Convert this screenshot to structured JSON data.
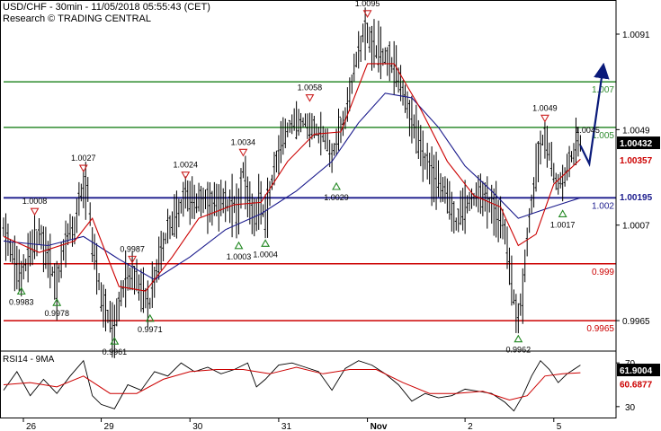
{
  "header": {
    "title": "USD/CHF - 30min - 11/05/2018 05:55:43 (CET)",
    "credit": "Research © TRADING CENTRAL"
  },
  "colors": {
    "candles": "#000000",
    "ma_fast": "#cc0000",
    "ma_slow": "#1a1a8c",
    "resistance": "#2e8b2e",
    "pivot": "#1a1a8c",
    "support": "#cc0000",
    "forecast_arrow": "#0a1a7a",
    "price_badge": "#000000",
    "fast_badge": "#cc0000",
    "pivot_badge": "#1a1a8c"
  },
  "chart_data": [
    {
      "type": "candlestick",
      "title": "USD/CHF - 30min - 11/05/2018 05:55:43 (CET)",
      "ylim": [
        0.9952,
        1.0106
      ],
      "y_ticks": [
        "1.0091",
        "1.0049",
        "1.0007",
        "0.9965"
      ],
      "x_ticks": [
        "26",
        "29",
        "30",
        "31",
        "Nov",
        "2",
        "5"
      ],
      "grid": false,
      "price_path": [
        {
          "x": 0,
          "y": 1.0006
        },
        {
          "x": 2,
          "y": 0.9994
        },
        {
          "x": 4,
          "y": 0.9985
        },
        {
          "x": 6,
          "y": 0.9995
        },
        {
          "x": 8,
          "y": 1.0003
        },
        {
          "x": 10,
          "y": 0.9993
        },
        {
          "x": 12,
          "y": 0.998
        },
        {
          "x": 14,
          "y": 1.0002
        },
        {
          "x": 16,
          "y": 1.0006
        },
        {
          "x": 18,
          "y": 1.0026
        },
        {
          "x": 19,
          "y": 1.0022
        },
        {
          "x": 20,
          "y": 1.0
        },
        {
          "x": 22,
          "y": 0.9975
        },
        {
          "x": 24,
          "y": 0.9965
        },
        {
          "x": 25,
          "y": 0.9963
        },
        {
          "x": 27,
          "y": 0.998
        },
        {
          "x": 29,
          "y": 0.9986
        },
        {
          "x": 31,
          "y": 0.9978
        },
        {
          "x": 33,
          "y": 0.9973
        },
        {
          "x": 35,
          "y": 0.9992
        },
        {
          "x": 37,
          "y": 1.0005
        },
        {
          "x": 39,
          "y": 1.001
        },
        {
          "x": 41,
          "y": 1.0022
        },
        {
          "x": 43,
          "y": 1.0016
        },
        {
          "x": 45,
          "y": 1.0018
        },
        {
          "x": 47,
          "y": 1.0017
        },
        {
          "x": 49,
          "y": 1.0018
        },
        {
          "x": 51,
          "y": 1.0016
        },
        {
          "x": 53,
          "y": 1.0014
        },
        {
          "x": 54,
          "y": 1.003
        },
        {
          "x": 55,
          "y": 1.0022
        },
        {
          "x": 56,
          "y": 1.0011
        },
        {
          "x": 58,
          "y": 1.0015
        },
        {
          "x": 59,
          "y": 1.001
        },
        {
          "x": 61,
          "y": 1.0031
        },
        {
          "x": 63,
          "y": 1.0046
        },
        {
          "x": 65,
          "y": 1.0052
        },
        {
          "x": 67,
          "y": 1.0053
        },
        {
          "x": 69,
          "y": 1.0051
        },
        {
          "x": 71,
          "y": 1.0048
        },
        {
          "x": 73,
          "y": 1.0044
        },
        {
          "x": 74,
          "y": 1.0035
        },
        {
          "x": 75,
          "y": 1.0045
        },
        {
          "x": 77,
          "y": 1.0055
        },
        {
          "x": 79,
          "y": 1.0075
        },
        {
          "x": 81,
          "y": 1.009
        },
        {
          "x": 82,
          "y": 1.0093
        },
        {
          "x": 83,
          "y": 1.0085
        },
        {
          "x": 85,
          "y": 1.0082
        },
        {
          "x": 87,
          "y": 1.008
        },
        {
          "x": 89,
          "y": 1.0072
        },
        {
          "x": 91,
          "y": 1.006
        },
        {
          "x": 93,
          "y": 1.0047
        },
        {
          "x": 95,
          "y": 1.0035
        },
        {
          "x": 97,
          "y": 1.0028
        },
        {
          "x": 99,
          "y": 1.0022
        },
        {
          "x": 101,
          "y": 1.0015
        },
        {
          "x": 102,
          "y": 1.0008
        },
        {
          "x": 103,
          "y": 1.0014
        },
        {
          "x": 105,
          "y": 1.0018
        },
        {
          "x": 107,
          "y": 1.002
        },
        {
          "x": 109,
          "y": 1.0017
        },
        {
          "x": 111,
          "y": 1.0013
        },
        {
          "x": 113,
          "y": 1.0005
        },
        {
          "x": 114,
          "y": 0.999
        },
        {
          "x": 115,
          "y": 0.9975
        },
        {
          "x": 116,
          "y": 0.9966
        },
        {
          "x": 117,
          "y": 0.9975
        },
        {
          "x": 118,
          "y": 1.0
        },
        {
          "x": 119,
          "y": 1.0015
        },
        {
          "x": 120,
          "y": 1.003
        },
        {
          "x": 121,
          "y": 1.0042
        },
        {
          "x": 122,
          "y": 1.0046
        },
        {
          "x": 123,
          "y": 1.004
        },
        {
          "x": 124,
          "y": 1.003
        },
        {
          "x": 125,
          "y": 1.0025
        },
        {
          "x": 126,
          "y": 1.0026
        },
        {
          "x": 127,
          "y": 1.0032
        },
        {
          "x": 128,
          "y": 1.0037
        },
        {
          "x": 129,
          "y": 1.0041
        },
        {
          "x": 130,
          "y": 1.0043
        }
      ],
      "ma_fast": [
        {
          "x": 0,
          "y": 1.0002
        },
        {
          "x": 8,
          "y": 0.9995
        },
        {
          "x": 16,
          "y": 1.0
        },
        {
          "x": 20,
          "y": 1.001
        },
        {
          "x": 26,
          "y": 0.998
        },
        {
          "x": 32,
          "y": 0.9978
        },
        {
          "x": 38,
          "y": 0.9993
        },
        {
          "x": 44,
          "y": 1.001
        },
        {
          "x": 52,
          "y": 1.0016
        },
        {
          "x": 58,
          "y": 1.0017
        },
        {
          "x": 64,
          "y": 1.0035
        },
        {
          "x": 70,
          "y": 1.0047
        },
        {
          "x": 76,
          "y": 1.0048
        },
        {
          "x": 82,
          "y": 1.0078
        },
        {
          "x": 88,
          "y": 1.0078
        },
        {
          "x": 94,
          "y": 1.0058
        },
        {
          "x": 100,
          "y": 1.0035
        },
        {
          "x": 106,
          "y": 1.002
        },
        {
          "x": 112,
          "y": 1.0015
        },
        {
          "x": 116,
          "y": 0.9998
        },
        {
          "x": 120,
          "y": 1.0003
        },
        {
          "x": 124,
          "y": 1.0025
        },
        {
          "x": 130,
          "y": 1.0036
        }
      ],
      "ma_slow": [
        {
          "x": 0,
          "y": 1.0
        },
        {
          "x": 10,
          "y": 0.9998
        },
        {
          "x": 18,
          "y": 1.0002
        },
        {
          "x": 26,
          "y": 0.9992
        },
        {
          "x": 34,
          "y": 0.9983
        },
        {
          "x": 42,
          "y": 0.9993
        },
        {
          "x": 50,
          "y": 1.0005
        },
        {
          "x": 58,
          "y": 1.0012
        },
        {
          "x": 66,
          "y": 1.0022
        },
        {
          "x": 74,
          "y": 1.0035
        },
        {
          "x": 80,
          "y": 1.0052
        },
        {
          "x": 86,
          "y": 1.0065
        },
        {
          "x": 92,
          "y": 1.0063
        },
        {
          "x": 98,
          "y": 1.005
        },
        {
          "x": 104,
          "y": 1.0033
        },
        {
          "x": 110,
          "y": 1.0022
        },
        {
          "x": 116,
          "y": 1.001
        },
        {
          "x": 122,
          "y": 1.0014
        },
        {
          "x": 130,
          "y": 1.0019
        }
      ],
      "levels": [
        {
          "value": 1.007,
          "label": "1.007",
          "kind": "resistance"
        },
        {
          "value": 1.005,
          "label": "1.005",
          "kind": "resistance"
        },
        {
          "value": 1.0019,
          "label": "1.002",
          "kind": "pivot"
        },
        {
          "value": 0.999,
          "label": "0.999",
          "kind": "support"
        },
        {
          "value": 0.9965,
          "label": "0.9965",
          "kind": "support"
        }
      ],
      "badges": [
        {
          "value": 1.00432,
          "label": "1.00432",
          "kind": "price"
        },
        {
          "value": 1.00357,
          "label": "1.00357",
          "kind": "fast"
        },
        {
          "value": 1.00195,
          "label": "1.00195",
          "kind": "pivot"
        }
      ],
      "annotations": [
        {
          "x": 4,
          "y": 0.9983,
          "label": "0.9983",
          "kind": "low"
        },
        {
          "x": 7,
          "y": 1.0008,
          "label": "1.0008",
          "kind": "high"
        },
        {
          "x": 12,
          "y": 0.9978,
          "label": "0.9978",
          "kind": "low"
        },
        {
          "x": 18,
          "y": 1.0027,
          "label": "1.0027",
          "kind": "high"
        },
        {
          "x": 25,
          "y": 0.9961,
          "label": "0.9961",
          "kind": "low"
        },
        {
          "x": 29,
          "y": 0.9987,
          "label": "0.9987",
          "kind": "high"
        },
        {
          "x": 33,
          "y": 0.9971,
          "label": "0.9971",
          "kind": "low"
        },
        {
          "x": 41,
          "y": 1.0024,
          "label": "1.0024",
          "kind": "high"
        },
        {
          "x": 54,
          "y": 1.0034,
          "label": "1.0034",
          "kind": "high"
        },
        {
          "x": 53,
          "y": 1.0003,
          "label": "1.0003",
          "kind": "low"
        },
        {
          "x": 59,
          "y": 1.0004,
          "label": "1.0004",
          "kind": "low"
        },
        {
          "x": 69,
          "y": 1.0058,
          "label": "1.0058",
          "kind": "high"
        },
        {
          "x": 75,
          "y": 1.0029,
          "label": "1.0029",
          "kind": "low"
        },
        {
          "x": 82,
          "y": 1.0095,
          "label": "1.0095",
          "kind": "high"
        },
        {
          "x": 116,
          "y": 0.9962,
          "label": "0.9962",
          "kind": "low"
        },
        {
          "x": 122,
          "y": 1.0049,
          "label": "1.0049",
          "kind": "high"
        },
        {
          "x": 126,
          "y": 1.0017,
          "label": "1.0017",
          "kind": "low"
        }
      ],
      "forecast_label": "1.0045",
      "forecast_path": [
        {
          "x": 130,
          "y": 1.0042
        },
        {
          "x": 132,
          "y": 1.0034
        },
        {
          "x": 135,
          "y": 1.0075
        }
      ]
    },
    {
      "type": "line",
      "title": "RSI14 - 9MA",
      "ylim": [
        20,
        80
      ],
      "y_ticks": [
        "70",
        "30"
      ],
      "rsi": [
        {
          "x": 0,
          "y": 45
        },
        {
          "x": 3,
          "y": 62
        },
        {
          "x": 6,
          "y": 40
        },
        {
          "x": 9,
          "y": 55
        },
        {
          "x": 12,
          "y": 42
        },
        {
          "x": 15,
          "y": 58
        },
        {
          "x": 18,
          "y": 72
        },
        {
          "x": 20,
          "y": 40
        },
        {
          "x": 22,
          "y": 32
        },
        {
          "x": 25,
          "y": 28
        },
        {
          "x": 28,
          "y": 50
        },
        {
          "x": 31,
          "y": 45
        },
        {
          "x": 34,
          "y": 62
        },
        {
          "x": 37,
          "y": 58
        },
        {
          "x": 40,
          "y": 70
        },
        {
          "x": 43,
          "y": 62
        },
        {
          "x": 46,
          "y": 66
        },
        {
          "x": 49,
          "y": 60
        },
        {
          "x": 52,
          "y": 64
        },
        {
          "x": 55,
          "y": 70
        },
        {
          "x": 57,
          "y": 48
        },
        {
          "x": 59,
          "y": 55
        },
        {
          "x": 62,
          "y": 68
        },
        {
          "x": 65,
          "y": 70
        },
        {
          "x": 68,
          "y": 66
        },
        {
          "x": 71,
          "y": 62
        },
        {
          "x": 74,
          "y": 45
        },
        {
          "x": 77,
          "y": 65
        },
        {
          "x": 80,
          "y": 72
        },
        {
          "x": 83,
          "y": 68
        },
        {
          "x": 86,
          "y": 60
        },
        {
          "x": 89,
          "y": 50
        },
        {
          "x": 92,
          "y": 35
        },
        {
          "x": 95,
          "y": 42
        },
        {
          "x": 98,
          "y": 38
        },
        {
          "x": 101,
          "y": 40
        },
        {
          "x": 104,
          "y": 46
        },
        {
          "x": 107,
          "y": 44
        },
        {
          "x": 110,
          "y": 42
        },
        {
          "x": 113,
          "y": 34
        },
        {
          "x": 115,
          "y": 26
        },
        {
          "x": 117,
          "y": 40
        },
        {
          "x": 119,
          "y": 58
        },
        {
          "x": 121,
          "y": 72
        },
        {
          "x": 123,
          "y": 64
        },
        {
          "x": 125,
          "y": 52
        },
        {
          "x": 127,
          "y": 60
        },
        {
          "x": 130,
          "y": 68
        }
      ],
      "ma9": [
        {
          "x": 0,
          "y": 50
        },
        {
          "x": 6,
          "y": 52
        },
        {
          "x": 12,
          "y": 48
        },
        {
          "x": 18,
          "y": 58
        },
        {
          "x": 24,
          "y": 42
        },
        {
          "x": 30,
          "y": 42
        },
        {
          "x": 36,
          "y": 55
        },
        {
          "x": 42,
          "y": 62
        },
        {
          "x": 48,
          "y": 64
        },
        {
          "x": 54,
          "y": 64
        },
        {
          "x": 60,
          "y": 60
        },
        {
          "x": 66,
          "y": 66
        },
        {
          "x": 72,
          "y": 60
        },
        {
          "x": 78,
          "y": 64
        },
        {
          "x": 84,
          "y": 64
        },
        {
          "x": 90,
          "y": 52
        },
        {
          "x": 96,
          "y": 42
        },
        {
          "x": 102,
          "y": 42
        },
        {
          "x": 108,
          "y": 44
        },
        {
          "x": 114,
          "y": 36
        },
        {
          "x": 118,
          "y": 40
        },
        {
          "x": 122,
          "y": 58
        },
        {
          "x": 126,
          "y": 60
        },
        {
          "x": 130,
          "y": 61
        }
      ],
      "badges": [
        {
          "value": 61.9004,
          "label": "61.9004",
          "kind": "rsi"
        },
        {
          "value": 60.6877,
          "label": "60.6877",
          "kind": "ma9"
        }
      ]
    }
  ]
}
